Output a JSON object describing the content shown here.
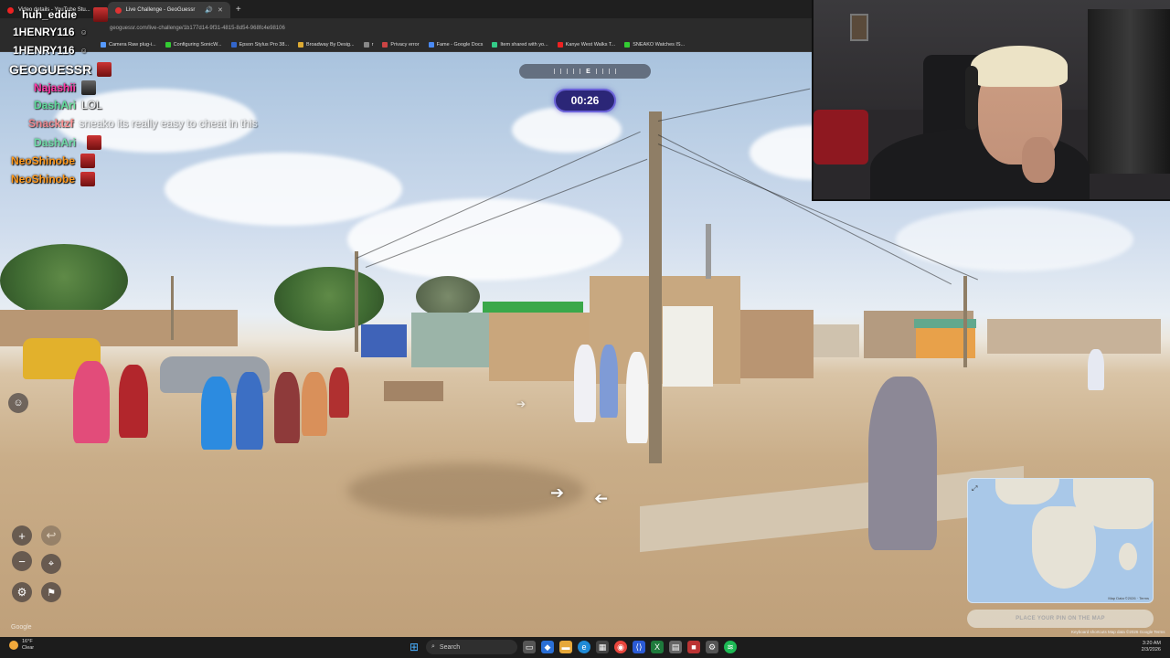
{
  "browser": {
    "tabs": [
      {
        "label": "Video details - YouTube Stu...",
        "color": "#e22"
      },
      {
        "label": "Live Challenge - GeoGuessr",
        "color": "#d33",
        "active": true
      }
    ],
    "url": "geoguessr.com/live-challenge/1b177d14-9f31-4815-8d54-968fc4e98106",
    "bookmarks": [
      {
        "label": "Camera Raw plug-i...",
        "color": "#59f"
      },
      {
        "label": "Configuring SonicW...",
        "color": "#3c3"
      },
      {
        "label": "Epson Stylus Pro 38...",
        "color": "#36c"
      },
      {
        "label": "Broadway By Desig...",
        "color": "#da3"
      },
      {
        "label": "r",
        "color": "#888"
      },
      {
        "label": "Privacy error",
        "color": "#c44"
      },
      {
        "label": "Fame - Google Docs",
        "color": "#4a8af4"
      },
      {
        "label": "Item shared with yo...",
        "color": "#3c8"
      },
      {
        "label": "Kanye West Walks T...",
        "color": "#e22"
      },
      {
        "label": "SNEAKO Watches IS...",
        "color": "#3c3"
      }
    ]
  },
  "chat": [
    {
      "user": "huh_eddie",
      "color": "#ffffff",
      "msg": ""
    },
    {
      "user": "1HENRY116",
      "color": "#ffffff",
      "msg": ""
    },
    {
      "user": "1HENRY116",
      "color": "#ffffff",
      "msg": ""
    },
    {
      "user": "GEOGUESSR",
      "color": "#ffffff",
      "msg": ""
    },
    {
      "user": "Najashii",
      "color": "#ff3aa8",
      "msg": ""
    },
    {
      "user": "DashAri",
      "color": "#39e07a",
      "msg": "LOL"
    },
    {
      "user": "Snacktzf",
      "color": "#ff6a6a",
      "msg": "sneako its really easy to cheat in this"
    },
    {
      "user": "DashAri",
      "color": "#39e07a",
      "msg": ""
    },
    {
      "user": "NeoShinobe",
      "color": "#ff9a1f",
      "msg": ""
    },
    {
      "user": "NeoShinobe",
      "color": "#ff9a1f",
      "msg": ""
    }
  ],
  "hud": {
    "compass_letter": "E",
    "timer": "00:26",
    "zoom_in": "+",
    "zoom_out": "−",
    "undo_icon": "↩",
    "google": "Google"
  },
  "minimap": {
    "keyboard": "Keyboard shortcuts",
    "attribution": "Map Data ©2026 · Terms",
    "place_pin": "PLACE YOUR PIN ON THE MAP",
    "footer": "Keyboard shortcuts   Map data ©2026 Google   Terms"
  },
  "taskbar": {
    "temp": "16°F",
    "weather": "Clear",
    "search": "Search",
    "time": "3:20 AM",
    "date": "2/3/2026"
  },
  "colors": {
    "timer_bg": "#2b2677",
    "timer_border": "#6b62d8",
    "taskbar": "#1c1c1c"
  }
}
